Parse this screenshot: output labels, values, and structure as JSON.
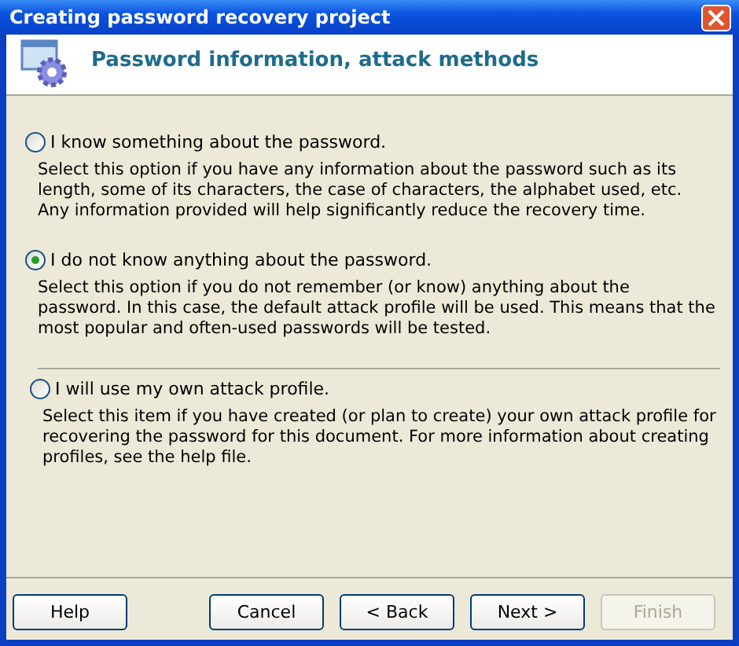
{
  "window": {
    "title": "Creating password recovery project"
  },
  "header": {
    "title": "Password information, attack methods"
  },
  "options": [
    {
      "label": "I know something about the password.",
      "description": "Select this option if you have any information about the password such as its length, some of its characters, the case of characters, the alphabet used, etc. Any information provided will help significantly reduce the recovery time.",
      "selected": false
    },
    {
      "label": "I do not know anything about the password.",
      "description": "Select this option if you do not remember (or know) anything about the password. In this case, the default attack profile will be used. This means that the most popular and often-used passwords will be tested.",
      "selected": true
    },
    {
      "label": "I will use my own attack profile.",
      "description": "Select this item if you have created (or plan to create) your own attack profile for recovering the password for this document. For more information about creating profiles, see the help file.",
      "selected": false
    }
  ],
  "buttons": [
    {
      "label": "Help",
      "disabled": false
    },
    {
      "label": "Cancel",
      "disabled": false
    },
    {
      "label": "< Back",
      "disabled": false
    },
    {
      "label": "Next >",
      "disabled": false
    },
    {
      "label": "Finish",
      "disabled": true
    }
  ]
}
